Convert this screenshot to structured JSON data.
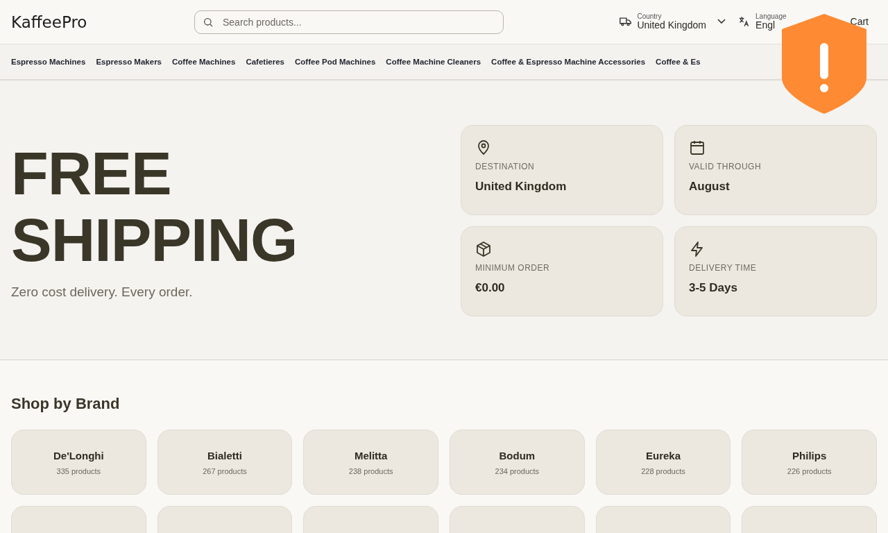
{
  "header": {
    "logo": "KaffeePro",
    "search": {
      "placeholder": "Search products..."
    },
    "country": {
      "label": "Country",
      "value": "United Kingdom"
    },
    "language": {
      "label": "Language",
      "value": "Engl"
    },
    "cart": {
      "label": "Cart"
    }
  },
  "nav": [
    "Espresso Machines",
    "Espresso Makers",
    "Coffee Machines",
    "Cafetieres",
    "Coffee Pod Machines",
    "Coffee Machine Cleaners",
    "Coffee & Espresso Machine Accessories",
    "Coffee & Es"
  ],
  "hero": {
    "title_lines": [
      "FREE",
      "SHIPPING"
    ],
    "subtitle": "Zero cost delivery. Every order.",
    "cards": [
      {
        "kind": "pin",
        "label": "DESTINATION",
        "value": "United Kingdom"
      },
      {
        "kind": "calendar",
        "label": "VALID THROUGH",
        "value": "August"
      },
      {
        "kind": "box",
        "label": "MINIMUM ORDER",
        "value": "€0.00"
      },
      {
        "kind": "bolt",
        "label": "DELIVERY TIME",
        "value": "3-5 Days"
      }
    ]
  },
  "brands": {
    "title": "Shop by Brand",
    "items": [
      {
        "name": "De'Longhi",
        "count": "335 products"
      },
      {
        "name": "Bialetti",
        "count": "267 products"
      },
      {
        "name": "Melitta",
        "count": "238 products"
      },
      {
        "name": "Bodum",
        "count": "234 products"
      },
      {
        "name": "Eureka",
        "count": "228 products"
      },
      {
        "name": "Philips",
        "count": "226 products"
      }
    ]
  }
}
